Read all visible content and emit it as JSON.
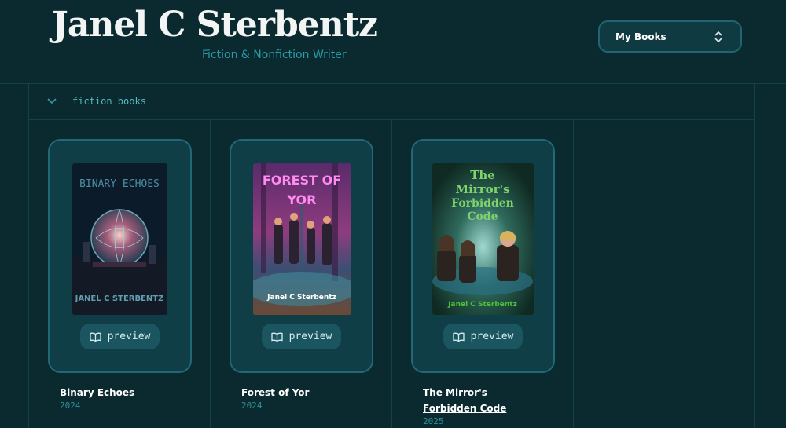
{
  "header": {
    "title": "Janel C Sterbentz",
    "subtitle": "Fiction & Nonfiction Writer",
    "select_label": "My Books"
  },
  "section": {
    "title": "fiction books"
  },
  "books": [
    {
      "title": "Binary Echoes",
      "year": "2024",
      "preview_label": "preview",
      "cover_title": "BINARY ECHOES",
      "cover_author": "JANEL C STERBENTZ"
    },
    {
      "title": "Forest of Yor",
      "year": "2024",
      "preview_label": "preview",
      "cover_title_line1": "FOREST OF",
      "cover_title_line2": "YOR",
      "cover_author": "Janel C Sterbentz"
    },
    {
      "title": "The Mirror's Forbidden Code",
      "year": "2025",
      "preview_label": "preview",
      "cover_title_line1": "The",
      "cover_title_line2": "Mirror's",
      "cover_title_line3": "Forbidden",
      "cover_title_line4": "Code",
      "cover_author": "Janel C Sterbentz"
    }
  ]
}
